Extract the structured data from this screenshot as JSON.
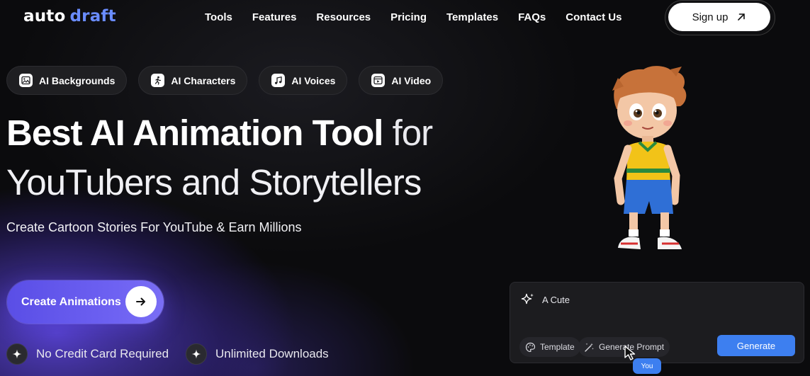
{
  "brand": {
    "logo_part1": "auto",
    "logo_part2": "draft",
    "logo_color": "#6a8cff"
  },
  "nav": {
    "items": [
      {
        "label": "Tools"
      },
      {
        "label": "Features"
      },
      {
        "label": "Resources"
      },
      {
        "label": "Pricing"
      },
      {
        "label": "Templates"
      },
      {
        "label": "FAQs"
      },
      {
        "label": "Contact Us"
      }
    ],
    "signup_label": "Sign up",
    "signup_icon": "arrow-up-right-icon"
  },
  "chips": [
    {
      "label": "AI Backgrounds",
      "icon": "image-icon"
    },
    {
      "label": "AI Characters",
      "icon": "running-figure-icon"
    },
    {
      "label": "AI Voices",
      "icon": "music-note-icon"
    },
    {
      "label": "AI Video",
      "icon": "video-icon"
    }
  ],
  "hero": {
    "title_bold": "Best AI Animation Tool",
    "title_light": "for",
    "title_line2": "YouTubers and Storytellers",
    "subtitle": "Create Cartoon Stories For YouTube & Earn Millions",
    "cta_label": "Create Animations",
    "cta_icon": "arrow-right-icon",
    "cta_color": "#5a4ee6"
  },
  "features": [
    {
      "label": "No Credit Card Required",
      "icon": "sparkle-icon"
    },
    {
      "label": "Unlimited Downloads",
      "icon": "sparkle-icon"
    }
  ],
  "prompt_panel": {
    "prompt_text": "A Cute",
    "template_label": "Template",
    "generate_prompt_label": "Generate Prompt",
    "generate_label": "Generate",
    "cursor_label": "You",
    "accent": "#3d7ff0"
  }
}
